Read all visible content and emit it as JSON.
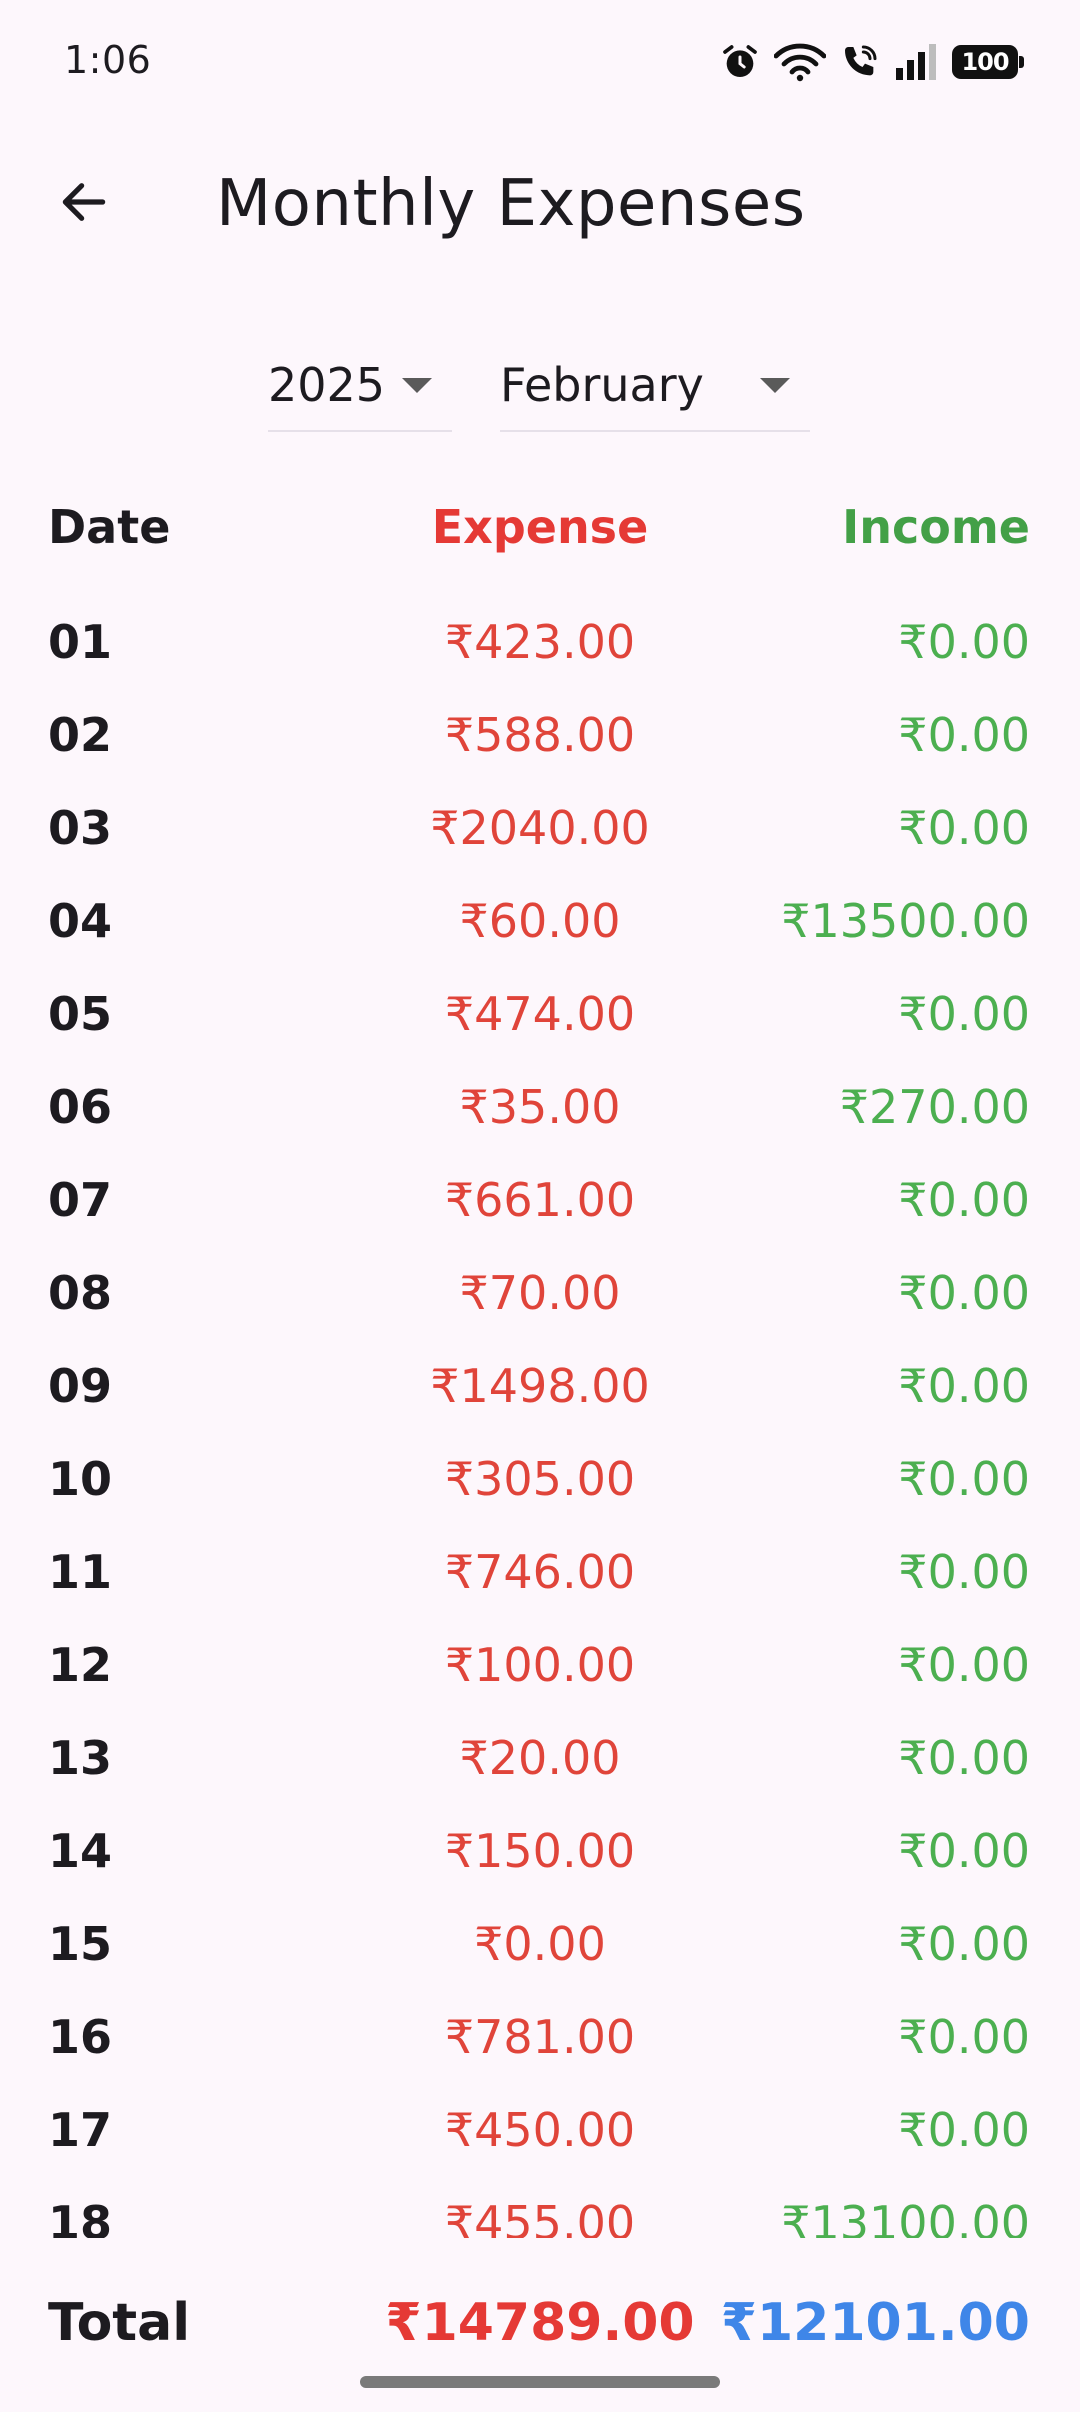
{
  "status_bar": {
    "time": "1:06",
    "battery": "100",
    "icons": [
      "alarm-icon",
      "wifi-icon",
      "wifi-calling-icon",
      "signal-icon",
      "battery-icon"
    ]
  },
  "app_bar": {
    "title": "Monthly Expenses",
    "back_icon": "arrow-left-icon"
  },
  "filters": {
    "year": "2025",
    "month": "February"
  },
  "table": {
    "headers": {
      "date": "Date",
      "expense": "Expense",
      "income": "Income"
    },
    "rows": [
      {
        "date": "01",
        "expense": "₹423.00",
        "income": "₹0.00"
      },
      {
        "date": "02",
        "expense": "₹588.00",
        "income": "₹0.00"
      },
      {
        "date": "03",
        "expense": "₹2040.00",
        "income": "₹0.00"
      },
      {
        "date": "04",
        "expense": "₹60.00",
        "income": "₹13500.00"
      },
      {
        "date": "05",
        "expense": "₹474.00",
        "income": "₹0.00"
      },
      {
        "date": "06",
        "expense": "₹35.00",
        "income": "₹270.00"
      },
      {
        "date": "07",
        "expense": "₹661.00",
        "income": "₹0.00"
      },
      {
        "date": "08",
        "expense": "₹70.00",
        "income": "₹0.00"
      },
      {
        "date": "09",
        "expense": "₹1498.00",
        "income": "₹0.00"
      },
      {
        "date": "10",
        "expense": "₹305.00",
        "income": "₹0.00"
      },
      {
        "date": "11",
        "expense": "₹746.00",
        "income": "₹0.00"
      },
      {
        "date": "12",
        "expense": "₹100.00",
        "income": "₹0.00"
      },
      {
        "date": "13",
        "expense": "₹20.00",
        "income": "₹0.00"
      },
      {
        "date": "14",
        "expense": "₹150.00",
        "income": "₹0.00"
      },
      {
        "date": "15",
        "expense": "₹0.00",
        "income": "₹0.00"
      },
      {
        "date": "16",
        "expense": "₹781.00",
        "income": "₹0.00"
      },
      {
        "date": "17",
        "expense": "₹450.00",
        "income": "₹0.00"
      },
      {
        "date": "18",
        "expense": "₹455.00",
        "income": "₹13100.00"
      }
    ]
  },
  "totals": {
    "label": "Total",
    "expense": "₹14789.00",
    "income": "₹12101.00"
  },
  "colors": {
    "expense": "#E53935",
    "income": "#43A047",
    "total_income": "#3F86E8",
    "background": "#FDF7FC"
  }
}
